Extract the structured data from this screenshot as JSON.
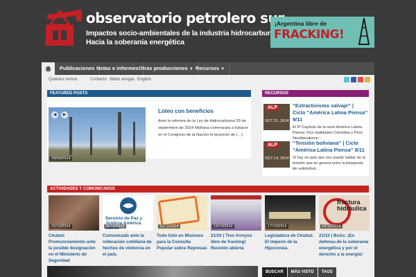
{
  "header": {
    "site_title": "observatorio petrolero sur",
    "tagline_line1": "Impactos socio-ambientales de la industria hidrocarburífera",
    "tagline_line2": "Hacia la soberanía energética",
    "banner_top": "¡Argentina libre de",
    "banner_main": "FRACKING!"
  },
  "nav": {
    "items": [
      {
        "label": "Publicaciones"
      },
      {
        "label": "Notas e informes"
      },
      {
        "label": "Otras producciones"
      },
      {
        "label": "Recursos"
      }
    ]
  },
  "subnav": {
    "items": [
      {
        "label": "Quiénes somos"
      },
      {
        "label": "Contacto"
      },
      {
        "label": "Webs amigas"
      },
      {
        "label": "English"
      }
    ]
  },
  "featured": {
    "heading": "FEATURED POSTS",
    "title": "Loteo con beneficios",
    "excerpt": "Ante la reforma de la Ley de Hidrocarburos 29 de septiembre de 2014 Mañana comenzará a tratarse en el Congreso de la Nación el proyecto de […]",
    "date": "29/09/2014"
  },
  "recursos": {
    "heading": "RECURSOS",
    "items": [
      {
        "title": "“Extractivismo salvaje” | Ciclo “América Latina Piensa” 9/11",
        "excerpt": "El 9º Capítulo de la serie América Latina Piensa: Dos realidades Colombia y Perú. Neoliberalismo…",
        "date": "OCT 21, 2014",
        "tag": "ALP"
      },
      {
        "title": "“Tensión boliviana” | Ciclo “América Latina Piensa” 8/11",
        "excerpt": "Si hay un país que nos puede hablar de la tensión que se genera entre la búsqueda de redistribuir…",
        "date": "OCT 14, 2014",
        "tag": "ALP"
      }
    ]
  },
  "actividades": {
    "heading": "ACTIVIDADES Y COMUNICADOS",
    "items": [
      {
        "text": "Chubut: Promunciamiento ante la posible designación en el Ministerio de Seguridad",
        "date": "22/10/2014"
      },
      {
        "text": "Comunicado ante la reiteración cotidiana de hechos de violencia en el país.",
        "date": "21/10/2014",
        "img_text": "Servicio de Paz y Justicia América Latina"
      },
      {
        "text": "Todo listo en Misiones para la Consulta Popular sobre Represas",
        "date": "19/10/2014"
      },
      {
        "text": "21/10 | Tres Arroyos libre de fracking! Reunión abierta",
        "date": "19/10/2014"
      },
      {
        "text": "Legisladura de Chubut: El imperio de la Hipocresía.",
        "date": "17/10/2014"
      },
      {
        "text": "21/10 | BsAs: ¡En defensa de la soberanía energética y por el derecho a la energía!",
        "date": "16/10/2014",
        "img_text": "fractura hidráulica"
      }
    ]
  },
  "bottom": {
    "tabs": [
      {
        "label": "BUSCAR"
      },
      {
        "label": "MÁS VISTO"
      },
      {
        "label": "TAGS"
      }
    ]
  },
  "colors": {
    "featured_head": "#1e5a8c",
    "recursos_head": "#8b1f7a",
    "actividades_head": "#c52222",
    "link": "#1e5a8c"
  }
}
